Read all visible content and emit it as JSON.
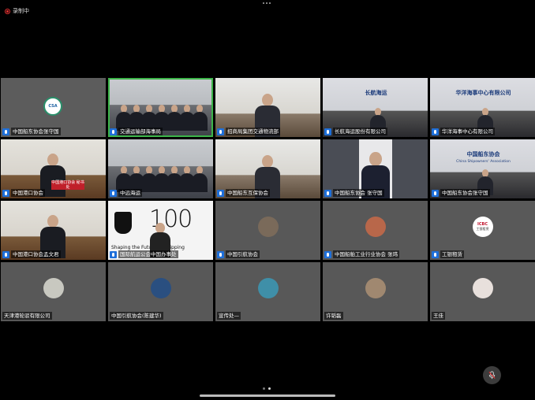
{
  "recording": {
    "label": "录制中"
  },
  "participants": [
    {
      "name": "中国船东协会张守国",
      "mic": true,
      "kind": "logo",
      "logo_text": "CSA"
    },
    {
      "name": "交通运输部海事局",
      "mic": true,
      "kind": "room",
      "active": true
    },
    {
      "name": "招商局集团交通物流部",
      "mic": true,
      "kind": "office"
    },
    {
      "name": "长航海运股份有限公司",
      "mic": true,
      "kind": "banner",
      "banner_text": "长航海运"
    },
    {
      "name": "华洋海事中心有限公司",
      "mic": true,
      "kind": "banner",
      "banner_text": "华洋海事中心有限公司"
    },
    {
      "name": "中国港口协会",
      "mic": true,
      "kind": "desk",
      "sign_text": "中国港口协会 秘书处"
    },
    {
      "name": "中远海运",
      "mic": true,
      "kind": "room"
    },
    {
      "name": "中国船东互保协会",
      "mic": true,
      "kind": "office"
    },
    {
      "name": "中国船东协会 张守国",
      "mic": true,
      "kind": "portrait"
    },
    {
      "name": "中国船东协会张守国",
      "mic": true,
      "kind": "banner",
      "banner_text": "中国船东协会",
      "banner_sub": "China Shipowners' Association"
    },
    {
      "name": "中国港口协会孟文君",
      "mic": true,
      "kind": "desk"
    },
    {
      "name": "国际航运公会中国办事处",
      "mic": true,
      "kind": "ics",
      "ics_text": "100",
      "ics_sub": "Shaping the Future of Shipping"
    },
    {
      "name": "中国引航协会",
      "mic": true,
      "kind": "avatar",
      "color": "#7a6a5a"
    },
    {
      "name": "中国船舶工业行业协会 张玮",
      "mic": true,
      "kind": "avatar",
      "color": "#b8674a"
    },
    {
      "name": "工银租赁",
      "mic": true,
      "kind": "icbc",
      "logo_text": "ICBC",
      "logo_sub": "工银租赁"
    },
    {
      "name": "天津港轮驳有限公司",
      "mic": false,
      "kind": "avatar",
      "color": "#c8c8c0"
    },
    {
      "name": "中国引航协会(陈建华)",
      "mic": false,
      "kind": "avatar",
      "color": "#2a4f80"
    },
    {
      "name": "宣传处—",
      "mic": false,
      "kind": "avatar",
      "color": "#3f8fa8"
    },
    {
      "name": "许韬磊",
      "mic": false,
      "kind": "avatar",
      "color": "#a08870"
    },
    {
      "name": "王佳",
      "mic": false,
      "kind": "avatar",
      "color": "#e8e0dc"
    }
  ],
  "icons": {
    "mic_button": "microphone-muted-icon",
    "more": "more-dots-icon"
  }
}
